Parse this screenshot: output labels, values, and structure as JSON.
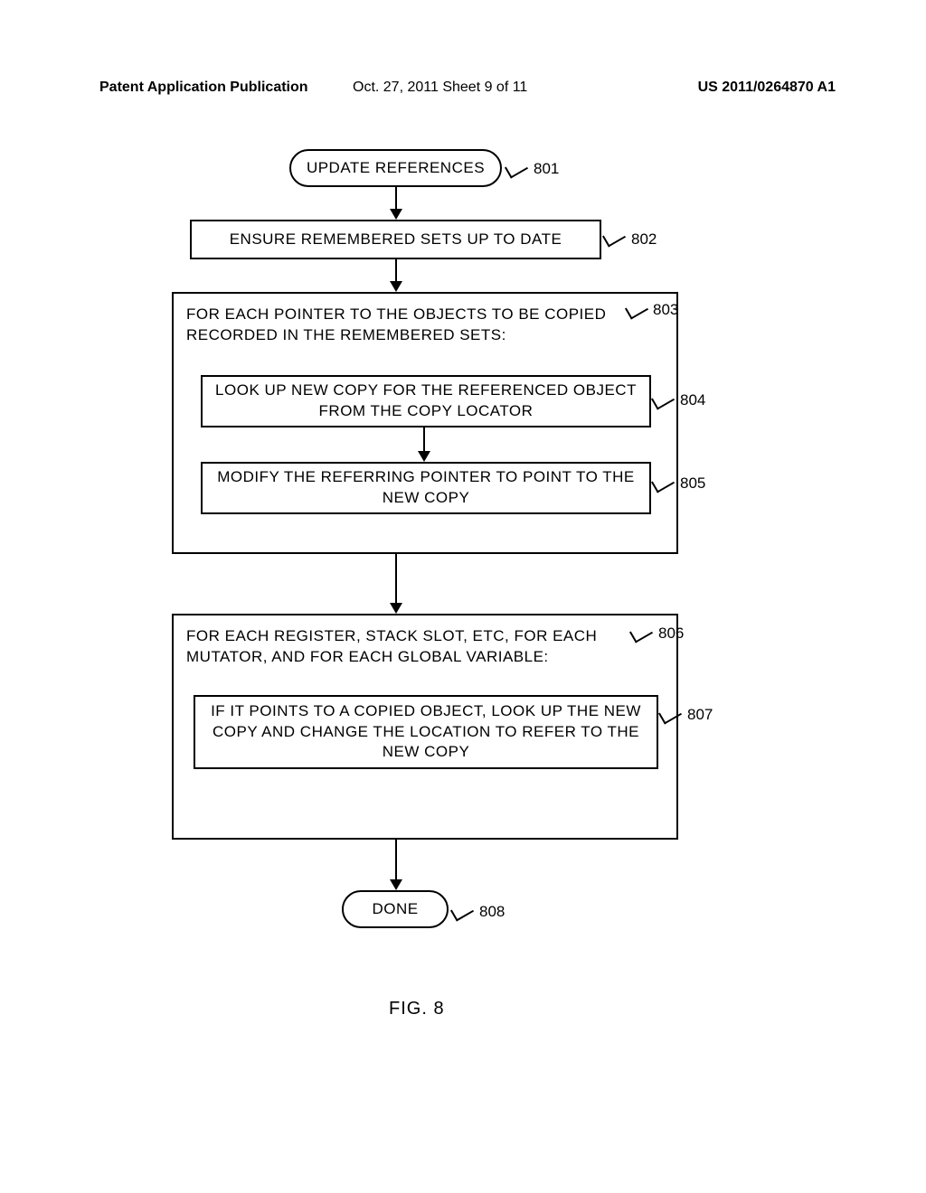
{
  "header": {
    "left": "Patent Application Publication",
    "center": "Oct. 27, 2011  Sheet 9 of 11",
    "right": "US 2011/0264870 A1"
  },
  "nodes": {
    "n801": "UPDATE REFERENCES",
    "n802": "ENSURE REMEMBERED SETS UP TO DATE",
    "n803": "FOR EACH POINTER TO THE OBJECTS TO BE COPIED RECORDED IN THE REMEMBERED SETS:",
    "n804": "LOOK UP NEW COPY FOR THE REFERENCED OBJECT FROM THE COPY LOCATOR",
    "n805": "MODIFY THE REFERRING POINTER TO POINT TO THE NEW COPY",
    "n806": "FOR EACH REGISTER, STACK SLOT, ETC, FOR EACH MUTATOR, AND FOR EACH GLOBAL VARIABLE:",
    "n807": "IF IT POINTS TO A COPIED OBJECT, LOOK UP THE NEW COPY AND CHANGE THE LOCATION TO REFER TO THE NEW COPY",
    "n808": "DONE"
  },
  "labels": {
    "l801": "801",
    "l802": "802",
    "l803": "803",
    "l804": "804",
    "l805": "805",
    "l806": "806",
    "l807": "807",
    "l808": "808"
  },
  "figure": "FIG. 8"
}
